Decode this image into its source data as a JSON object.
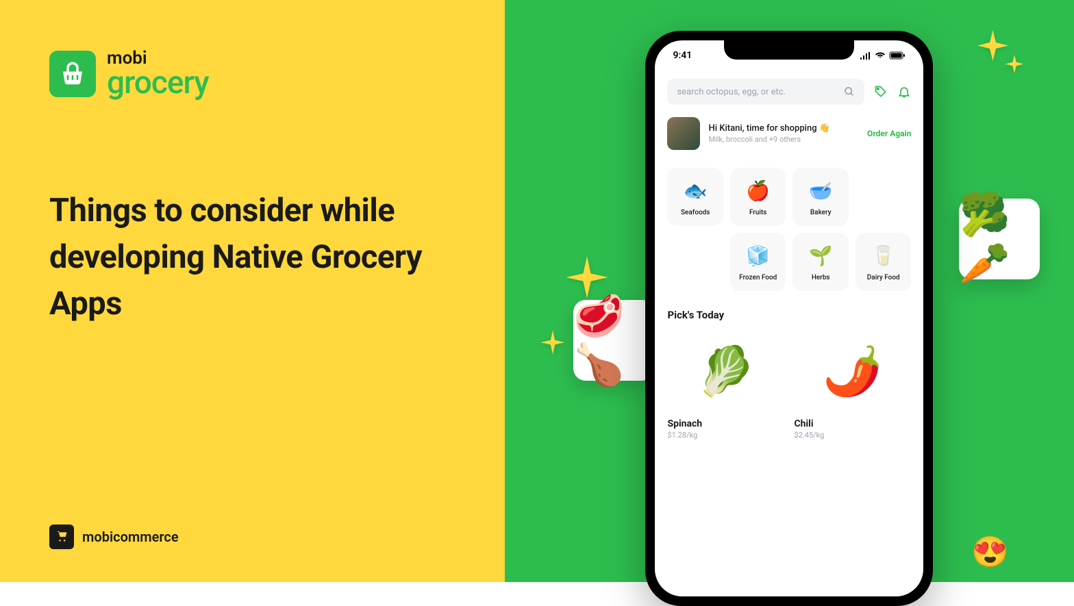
{
  "logo": {
    "mobi": "mobi",
    "grocery": "grocery"
  },
  "headline": "Things to consider while developing Native Grocery Apps",
  "footer": {
    "brand": "mobicommerce"
  },
  "phone": {
    "time": "9:41",
    "search_placeholder": "search octopus, egg, or etc.",
    "greeting": {
      "main": "Hi Kitani, time for shopping 👋",
      "sub": "Milk, broccoli and +9 others",
      "cta": "Order Again"
    },
    "categories": [
      {
        "label": "Seafoods",
        "icon": "🐟"
      },
      {
        "label": "Fruits",
        "icon": "🍎"
      },
      {
        "label": "Bakery",
        "icon": "🥣"
      },
      {
        "label": "",
        "icon": ""
      },
      {
        "label": "Frozen Food",
        "icon": "🧊"
      },
      {
        "label": "Herbs",
        "icon": "🌱"
      },
      {
        "label": "Dairy Food",
        "icon": "🥛"
      }
    ],
    "section_title": "Pick's Today",
    "products": [
      {
        "name": "Spinach",
        "price": "$1.28/kg",
        "emoji": "🥬"
      },
      {
        "name": "Chili",
        "price": "$2.45/kg",
        "emoji": "🌶️"
      }
    ]
  },
  "floats": {
    "meat": "🥩🍗",
    "veg": "🥦🥕",
    "heart": "😍"
  }
}
